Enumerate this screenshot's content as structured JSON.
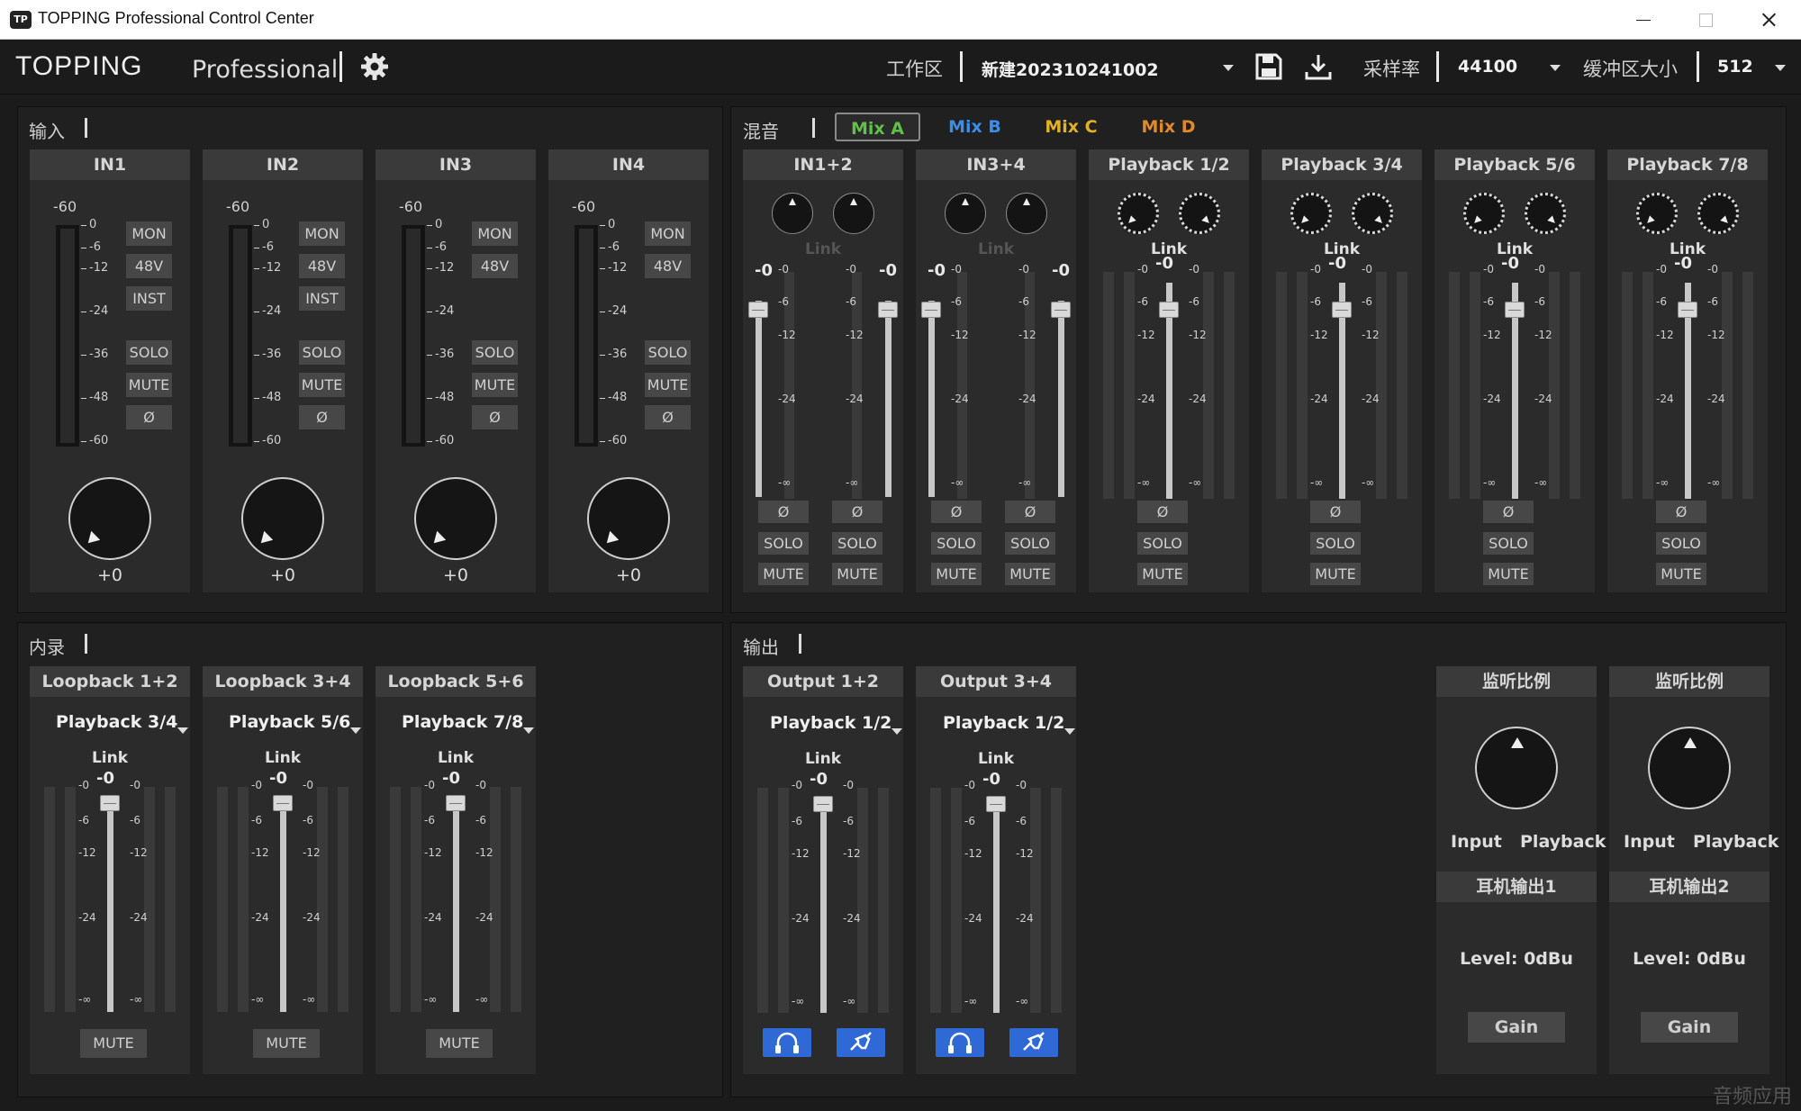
{
  "window": {
    "icon_text": "TP",
    "title": "TOPPING Professional Control Center"
  },
  "toolbar": {
    "brand": "TOPPING",
    "brand_sub": "Professional",
    "workspace_label": "工作区",
    "workspace_value": "新建202310241002",
    "samplerate_label": "采样率",
    "samplerate_value": "44100",
    "buffer_label": "缓冲区大小",
    "buffer_value": "512"
  },
  "input_section": {
    "title": "输入",
    "channels": [
      {
        "name": "IN1",
        "gain": "+0",
        "buttons": [
          "MON",
          "48V",
          "INST",
          "SOLO",
          "MUTE",
          "Ø"
        ]
      },
      {
        "name": "IN2",
        "gain": "+0",
        "buttons": [
          "MON",
          "48V",
          "INST",
          "SOLO",
          "MUTE",
          "Ø"
        ]
      },
      {
        "name": "IN3",
        "gain": "+0",
        "buttons": [
          "MON",
          "48V",
          "SOLO",
          "MUTE",
          "Ø"
        ]
      },
      {
        "name": "IN4",
        "gain": "+0",
        "buttons": [
          "MON",
          "48V",
          "SOLO",
          "MUTE",
          "Ø"
        ]
      }
    ],
    "scale_top": "-60",
    "scale": [
      "0",
      "-6",
      "-12",
      "-24",
      "-36",
      "-48",
      "-60"
    ]
  },
  "mix_section": {
    "title": "混音",
    "tabs": [
      {
        "label": "Mix A",
        "color": "#5fc04a"
      },
      {
        "label": "Mix B",
        "color": "#3b8ee8"
      },
      {
        "label": "Mix C",
        "color": "#e0b22a"
      },
      {
        "label": "Mix D",
        "color": "#e08a2a"
      }
    ],
    "active_tab": "Mix A",
    "channels": [
      {
        "name": "IN1+2",
        "link": "Link",
        "linked": false,
        "left_db": "-0",
        "right_db": "-0"
      },
      {
        "name": "IN3+4",
        "link": "Link",
        "linked": false,
        "left_db": "-0",
        "right_db": "-0"
      },
      {
        "name": "Playback 1/2",
        "link": "Link",
        "linked": true,
        "db": "-0"
      },
      {
        "name": "Playback 3/4",
        "link": "Link",
        "linked": true,
        "db": "-0"
      },
      {
        "name": "Playback 5/6",
        "link": "Link",
        "linked": true,
        "db": "-0"
      },
      {
        "name": "Playback 7/8",
        "link": "Link",
        "linked": true,
        "db": "-0"
      }
    ],
    "scale": [
      "-0",
      "-6",
      "-12",
      "-24",
      "-∞"
    ],
    "buttons": {
      "phase": "Ø",
      "solo": "SOLO",
      "mute": "MUTE"
    }
  },
  "loopback_section": {
    "title": "内录",
    "channels": [
      {
        "name": "Loopback 1+2",
        "source": "Playback 3/4",
        "link": "Link",
        "db": "-0",
        "mute": "MUTE"
      },
      {
        "name": "Loopback 3+4",
        "source": "Playback 5/6",
        "link": "Link",
        "db": "-0",
        "mute": "MUTE"
      },
      {
        "name": "Loopback 5+6",
        "source": "Playback 7/8",
        "link": "Link",
        "db": "-0",
        "mute": "MUTE"
      }
    ]
  },
  "output_section": {
    "title": "输出",
    "channels": [
      {
        "name": "Output 1+2",
        "source": "Playback 1/2",
        "link": "Link",
        "db": "-0"
      },
      {
        "name": "Output 3+4",
        "source": "Playback 1/2",
        "link": "Link",
        "db": "-0"
      }
    ],
    "monitor": [
      {
        "title": "监听比例",
        "left": "Input",
        "right": "Playback",
        "hp_title": "耳机输出1",
        "level": "Level:  0dBu",
        "gain": "Gain"
      },
      {
        "title": "监听比例",
        "left": "Input",
        "right": "Playback",
        "hp_title": "耳机输出2",
        "level": "Level:  0dBu",
        "gain": "Gain"
      }
    ]
  },
  "watermark": "音频应用"
}
